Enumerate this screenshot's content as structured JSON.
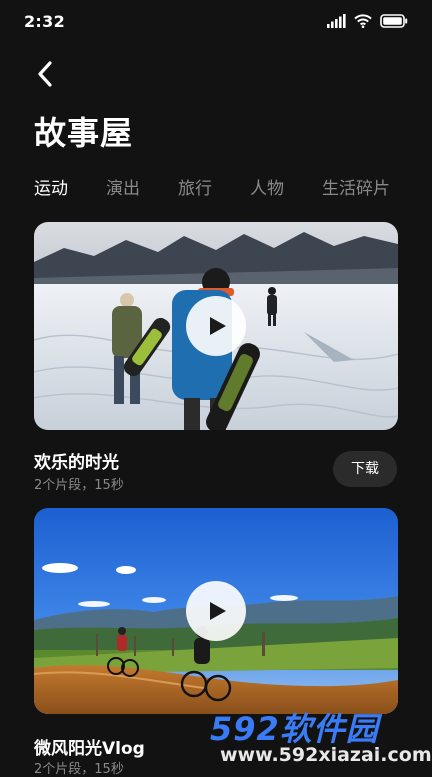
{
  "status_bar": {
    "time": "2:32",
    "icons": [
      "signal-icon",
      "wifi-icon",
      "battery-icon"
    ]
  },
  "header": {
    "back_icon": "back-icon",
    "title": "故事屋"
  },
  "tabs": [
    {
      "label": "运动",
      "active": true
    },
    {
      "label": "演出",
      "active": false
    },
    {
      "label": "旅行",
      "active": false
    },
    {
      "label": "人物",
      "active": false
    },
    {
      "label": "生活碎片",
      "active": false
    }
  ],
  "cards": [
    {
      "title": "欢乐的时光",
      "meta": "2个片段，15秒",
      "action_label": "下载",
      "image": "snowboarders walking on a snowy slope"
    },
    {
      "title": "微风阳光Vlog",
      "meta": "2个片段，15秒",
      "image": "cyclists on a dirt trail under a blue sky"
    }
  ],
  "watermark": {
    "logo": "592软件园",
    "url": "www.592xiazai.com"
  },
  "colors": {
    "background": "#121212",
    "text": "#ffffff",
    "muted": "#8a8a8a",
    "button_bg": "#2b2b2b",
    "watermark_blue": "#3a7cf5"
  }
}
